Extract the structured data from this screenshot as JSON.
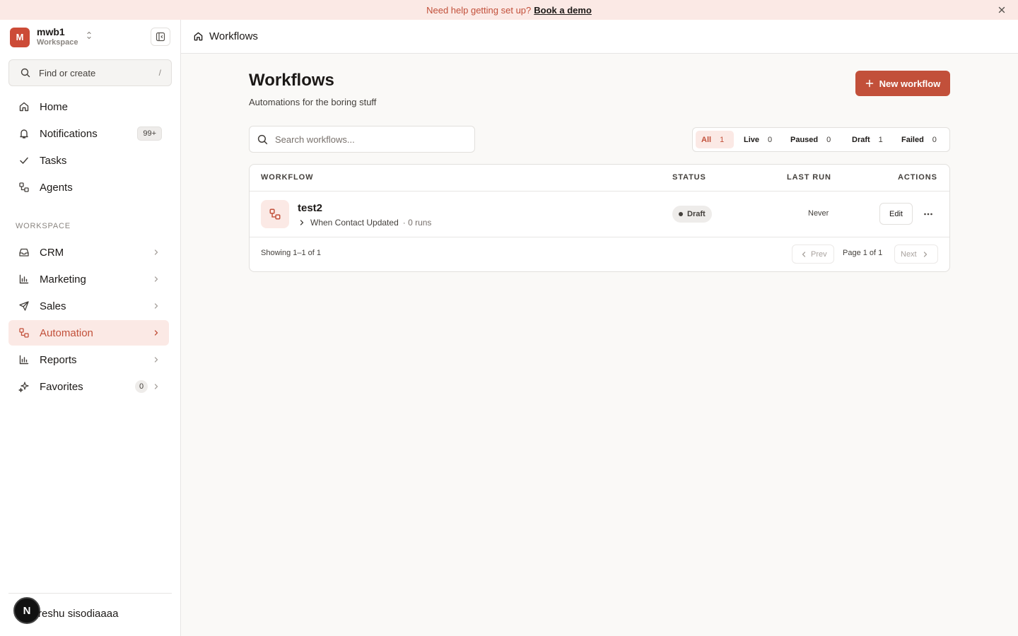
{
  "banner": {
    "text": "Need help getting set up?",
    "link": "Book a demo"
  },
  "workspace": {
    "initial": "M",
    "name": "mwb1",
    "subtitle": "Workspace"
  },
  "find": {
    "placeholder": "Find or create",
    "shortcut": "/"
  },
  "nav": {
    "home": "Home",
    "notifications": "Notifications",
    "notifications_badge": "99+",
    "tasks": "Tasks",
    "agents": "Agents"
  },
  "section_label": "WORKSPACE",
  "workspace_nav": {
    "crm": "CRM",
    "marketing": "Marketing",
    "sales": "Sales",
    "automation": "Automation",
    "reports": "Reports",
    "favorites": "Favorites",
    "favorites_count": "0"
  },
  "user": {
    "initial": "N",
    "name": "reshu sisodiaaaa"
  },
  "breadcrumb": "Workflows",
  "page": {
    "title": "Workflows",
    "subtitle": "Automations for the boring stuff",
    "new_button": "New workflow"
  },
  "search": {
    "placeholder": "Search workflows..."
  },
  "filters": [
    {
      "label": "All",
      "count": "1",
      "active": true
    },
    {
      "label": "Live",
      "count": "0"
    },
    {
      "label": "Paused",
      "count": "0"
    },
    {
      "label": "Draft",
      "count": "1"
    },
    {
      "label": "Failed",
      "count": "0"
    }
  ],
  "table": {
    "headers": {
      "workflow": "WORKFLOW",
      "status": "STATUS",
      "last_run": "LAST RUN",
      "actions": "ACTIONS"
    },
    "rows": [
      {
        "name": "test2",
        "trigger": "When Contact Updated",
        "runs": "· 0 runs",
        "status": "Draft",
        "last_run": "Never",
        "edit": "Edit"
      }
    ],
    "showing": "Showing 1–1 of 1",
    "prev": "Prev",
    "page_info": "Page 1 of 1",
    "next": "Next"
  },
  "colors": {
    "accent": "#c2503a",
    "accent_soft": "#fbe9e5",
    "banner_bg": "#fbe9e5"
  }
}
